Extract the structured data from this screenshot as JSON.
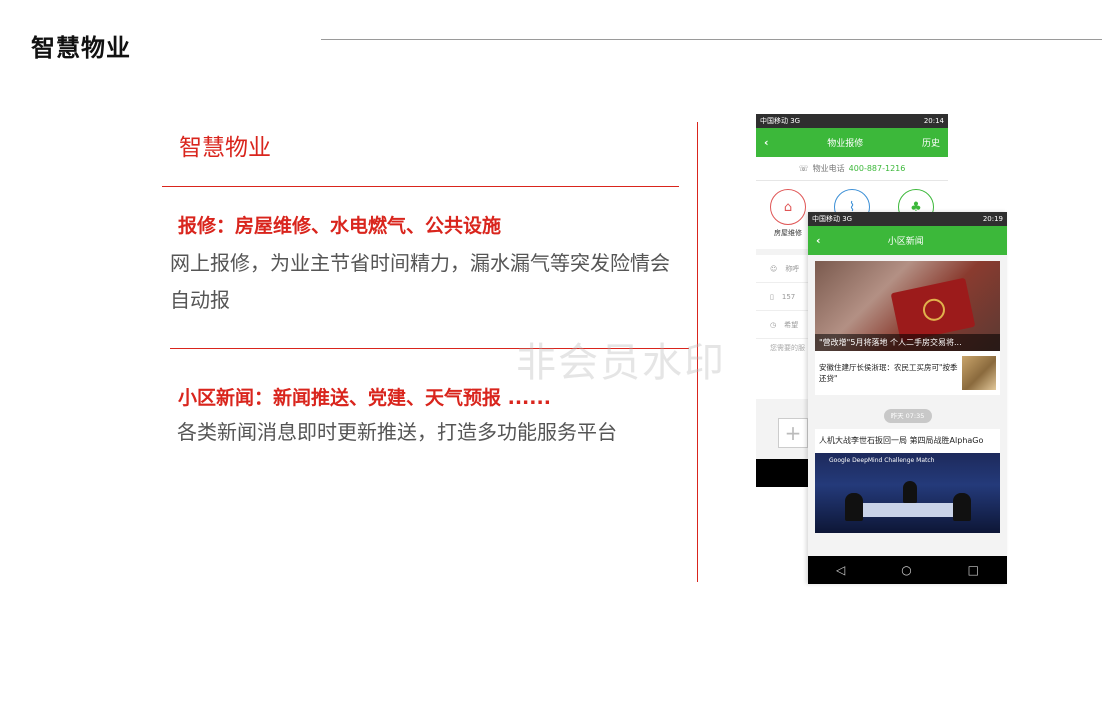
{
  "header": {
    "title": "智慧物业"
  },
  "section": {
    "title": "智慧物业"
  },
  "features": [
    {
      "heading": "报修：房屋维修、水电燃气、公共设施",
      "body": "网上报修，为业主节省时间精力，漏水漏气等突发险情会自动报"
    },
    {
      "heading": "小区新闻：新闻推送、党建、天气预报 ......",
      "body": "各类新闻消息即时更新推送，打造多功能服务平台"
    }
  ],
  "watermark": "非会员水印",
  "phone1": {
    "status_left": "中国移动 3G",
    "status_time": "20:14",
    "app_title": "物业报修",
    "app_action": "历史",
    "phone_label": "物业电话",
    "phone_number": "400-887-1216",
    "category_label": "房屋维修",
    "row1": "称呼",
    "row2": "157",
    "row3": "希望",
    "textarea_placeholder": "您需要的服",
    "plus": "+"
  },
  "phone2": {
    "status_left": "中国移动 3G",
    "status_time": "20:19",
    "app_title": "小区新闻",
    "hero_caption": "\"营改增\"5月将落地 个人二手房交易将...",
    "item_text": "安徽住建厅长侯淅珉：农民工买房可\"按季还贷\"",
    "time_badge": "昨天 07:35",
    "card2_title": "人机大战李世石扳回一局 第四局战胜AlphaGo",
    "card2_banner": "Google DeepMind Challenge Match",
    "nav_back": "◁",
    "nav_home": "○",
    "nav_recent": "□"
  },
  "colors": {
    "accent_red": "#d9251d",
    "app_green": "#3cb83a"
  }
}
